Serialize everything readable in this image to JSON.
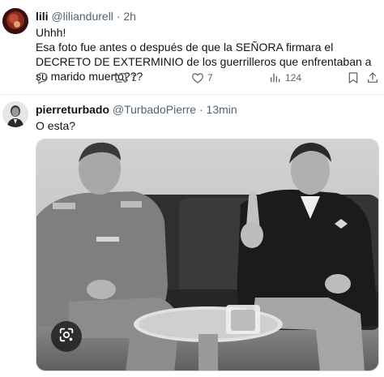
{
  "tweets": [
    {
      "name": "lili",
      "handle": "@liliandurell",
      "sep": "·",
      "time": "2h",
      "line1": "Uhhh!",
      "line2": "Esa foto fue antes o después de que la SEÑORA firmara el DECRETO DE EXTERMINIO de los guerrilleros que enfrentaban a su marido muerto???",
      "actions": {
        "reply_count": "",
        "retweet_count": "1",
        "like_count": "7",
        "view_count": "124"
      }
    },
    {
      "name": "pierreturbado",
      "handle": "@TurbadoPierre",
      "sep": "·",
      "time": "13min",
      "line1": "O esta?"
    }
  ],
  "icons": {
    "reply": "reply-icon",
    "retweet": "retweet-icon",
    "like": "heart-icon",
    "views": "views-icon",
    "bookmark": "bookmark-icon",
    "share": "share-icon",
    "lens": "google-lens-icon"
  },
  "colors": {
    "text": "#0f1419",
    "secondary": "#536471",
    "divider": "#eff3f4"
  }
}
